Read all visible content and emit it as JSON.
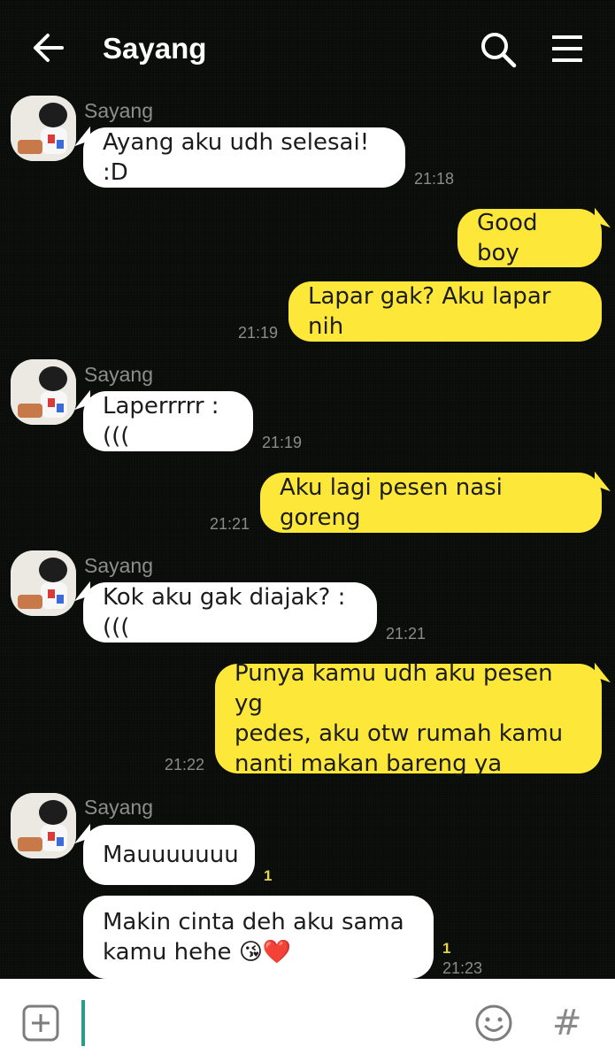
{
  "header": {
    "title": "Sayang",
    "back_icon": "arrow-left-icon",
    "search_icon": "search-icon",
    "menu_icon": "hamburger-menu-icon"
  },
  "messages": [
    {
      "direction": "in",
      "sender": "Sayang",
      "text": "Ayang aku udh selesai! :D",
      "time": "21:18"
    },
    {
      "direction": "out",
      "text": "Good boy",
      "time": ""
    },
    {
      "direction": "out",
      "text": "Lapar gak? Aku lapar nih",
      "time": "21:19"
    },
    {
      "direction": "in",
      "sender": "Sayang",
      "text": "Laperrrrr :(((",
      "time": "21:19"
    },
    {
      "direction": "out",
      "text": "Aku lagi pesen nasi goreng",
      "time": "21:21"
    },
    {
      "direction": "in",
      "sender": "Sayang",
      "text": "Kok aku gak diajak? :(((",
      "time": "21:21"
    },
    {
      "direction": "out",
      "text": "Punya kamu udh aku pesen yg\npedes, aku otw rumah kamu\nnanti makan bareng ya",
      "time": "21:22"
    },
    {
      "direction": "in",
      "sender": "Sayang",
      "text": "Mauuuuuuu",
      "unread": "1",
      "time": ""
    },
    {
      "direction": "in",
      "text": "Makin cinta deh aku sama\nkamu hehe 😘❤️",
      "unread": "1",
      "time": "21:23"
    }
  ],
  "input": {
    "placeholder": "",
    "plus_icon": "plus-square-icon",
    "emoji_icon": "smiley-icon",
    "hash_label": "#"
  },
  "colors": {
    "background": "#0a0c0a",
    "outgoing_bubble": "#fde83a",
    "incoming_bubble": "#ffffff",
    "unread_count": "#e6d545",
    "input_caret": "#2b9b8a"
  }
}
